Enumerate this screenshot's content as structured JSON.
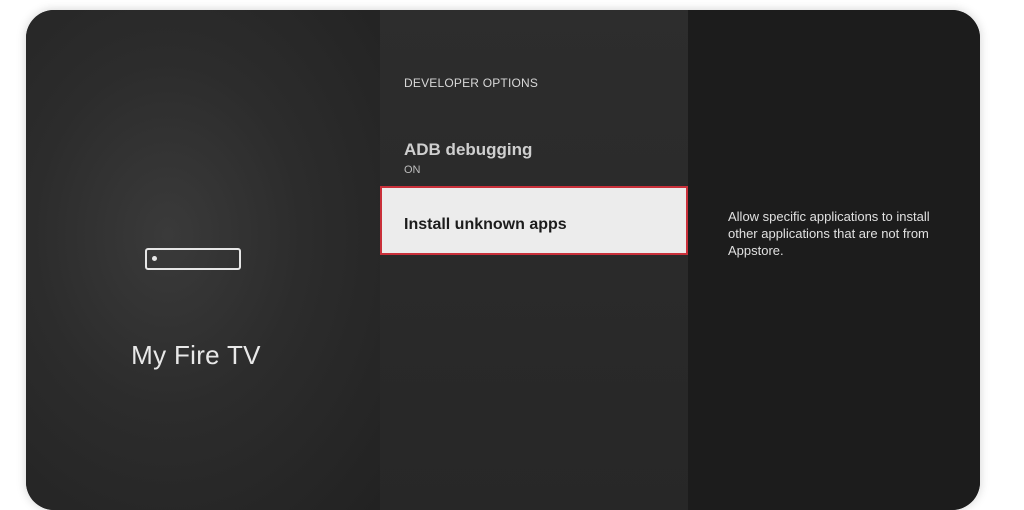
{
  "device": {
    "icon": "fire-tv-device-icon",
    "name": "My Fire TV"
  },
  "menu": {
    "section_heading": "DEVELOPER OPTIONS",
    "items": [
      {
        "label": "ADB debugging",
        "status": "ON"
      },
      {
        "label": "Install unknown apps",
        "selected": true
      }
    ]
  },
  "details": {
    "description": "Allow specific applications to install other applications that are not from Appstore."
  },
  "colors": {
    "selection_border": "#c9303a",
    "selection_background": "#ececec"
  }
}
